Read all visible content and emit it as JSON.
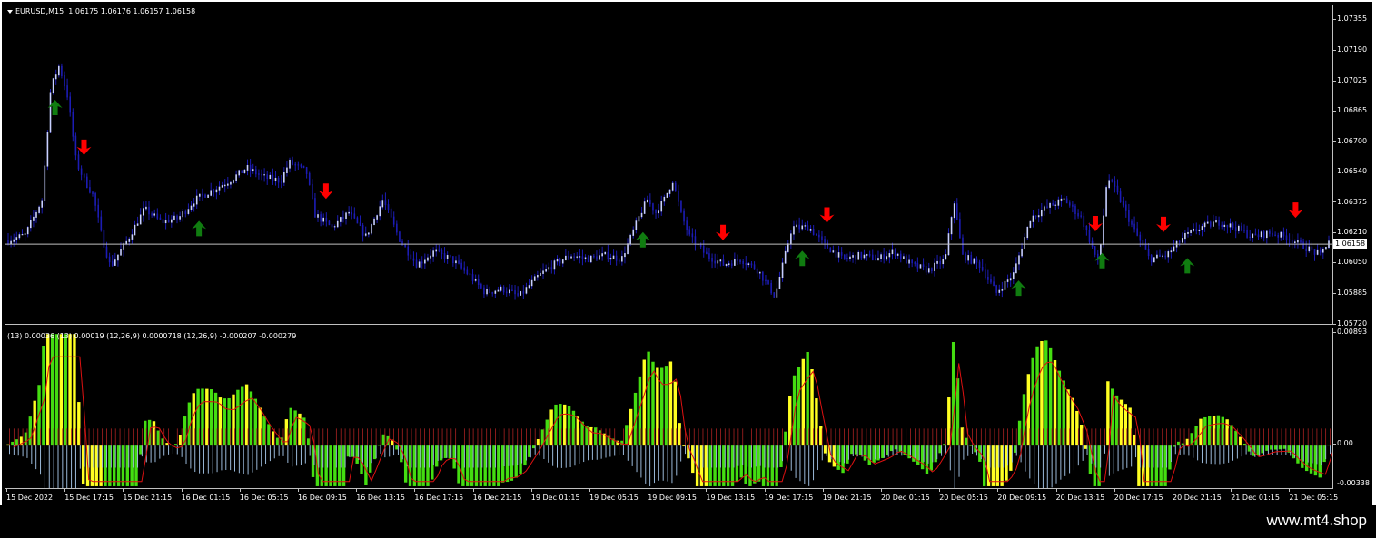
{
  "window": {
    "symbol_label": "EURUSD,M15",
    "ohlc": "1.06175 1.06176 1.06157 1.06158",
    "current_price": "1.06158"
  },
  "indicator_label": "(13) 0.00036  (13) 0.00019  (12,26,9) 0.0000718  (12,26,9) -0.000207 -0.000279",
  "watermark": "www.mt4.shop",
  "colors": {
    "background": "#000000",
    "candle": "#1c1cb4",
    "candle_highlight": "#c8d0ff",
    "bid_line": "#c0c0c0",
    "buy_arrow": "#107c10",
    "sell_arrow": "#ff0000",
    "bull_power": "#44dd11",
    "bear_power": "#ffff22",
    "macd_line": "#dd1111",
    "macd_hist": "#9ab8d8",
    "signal_hist": "#aa2222"
  },
  "icons": {
    "buy": "arrow-up-icon",
    "sell": "arrow-down-icon",
    "collapse": "triangle-down-icon"
  },
  "price_axis": [
    "1.07355",
    "1.07190",
    "1.07025",
    "1.06865",
    "1.06700",
    "1.06540",
    "1.06375",
    "1.06210",
    "1.06050",
    "1.05885",
    "1.05720"
  ],
  "indicator_axis": [
    "0.00893",
    "0.00",
    "-0.00338"
  ],
  "time_axis": [
    "15 Dec 2022",
    "15 Dec 17:15",
    "15 Dec 21:15",
    "16 Dec 01:15",
    "16 Dec 05:15",
    "16 Dec 09:15",
    "16 Dec 13:15",
    "16 Dec 17:15",
    "16 Dec 21:15",
    "19 Dec 01:15",
    "19 Dec 05:15",
    "19 Dec 09:15",
    "19 Dec 13:15",
    "19 Dec 17:15",
    "19 Dec 21:15",
    "20 Dec 01:15",
    "20 Dec 05:15",
    "20 Dec 09:15",
    "20 Dec 13:15",
    "20 Dec 17:15",
    "20 Dec 21:15",
    "21 Dec 01:15",
    "21 Dec 05:15"
  ],
  "chart_data": {
    "type": "line",
    "instrument": "EURUSD",
    "timeframe": "M15",
    "ylim": [
      1.0572,
      1.0744
    ],
    "bid": 1.06158,
    "price_path": [
      [
        0,
        1.0618
      ],
      [
        2,
        1.0621
      ],
      [
        4,
        1.064
      ],
      [
        5,
        1.07
      ],
      [
        6,
        1.0712
      ],
      [
        7,
        1.0695
      ],
      [
        8,
        1.066
      ],
      [
        9,
        1.065
      ],
      [
        10,
        1.0642
      ],
      [
        11,
        1.062
      ],
      [
        12,
        1.0604
      ],
      [
        14,
        1.0618
      ],
      [
        16,
        1.0635
      ],
      [
        18,
        1.0628
      ],
      [
        20,
        1.063
      ],
      [
        22,
        1.064
      ],
      [
        24,
        1.0645
      ],
      [
        26,
        1.065
      ],
      [
        28,
        1.0657
      ],
      [
        30,
        1.0652
      ],
      [
        32,
        1.065
      ],
      [
        33,
        1.066
      ],
      [
        35,
        1.0655
      ],
      [
        36,
        1.0632
      ],
      [
        38,
        1.0625
      ],
      [
        40,
        1.0633
      ],
      [
        42,
        1.062
      ],
      [
        44,
        1.064
      ],
      [
        46,
        1.0618
      ],
      [
        48,
        1.0605
      ],
      [
        50,
        1.0612
      ],
      [
        52,
        1.0608
      ],
      [
        54,
        1.06
      ],
      [
        56,
        1.059
      ],
      [
        58,
        1.0592
      ],
      [
        60,
        1.0588
      ],
      [
        62,
        1.0598
      ],
      [
        64,
        1.0605
      ],
      [
        66,
        1.061
      ],
      [
        68,
        1.0608
      ],
      [
        70,
        1.061
      ],
      [
        72,
        1.0608
      ],
      [
        74,
        1.063
      ],
      [
        75,
        1.064
      ],
      [
        76,
        1.0633
      ],
      [
        77,
        1.064
      ],
      [
        78,
        1.065
      ],
      [
        79,
        1.0632
      ],
      [
        80,
        1.062
      ],
      [
        82,
        1.061
      ],
      [
        84,
        1.0605
      ],
      [
        86,
        1.0608
      ],
      [
        88,
        1.0602
      ],
      [
        90,
        1.0588
      ],
      [
        92,
        1.0625
      ],
      [
        94,
        1.0625
      ],
      [
        96,
        1.0615
      ],
      [
        98,
        1.0608
      ],
      [
        100,
        1.061
      ],
      [
        102,
        1.0608
      ],
      [
        104,
        1.0612
      ],
      [
        106,
        1.0605
      ],
      [
        108,
        1.0602
      ],
      [
        110,
        1.0608
      ],
      [
        111,
        1.064
      ],
      [
        112,
        1.061
      ],
      [
        114,
        1.0605
      ],
      [
        116,
        1.059
      ],
      [
        118,
        1.06
      ],
      [
        120,
        1.063
      ],
      [
        122,
        1.0636
      ],
      [
        124,
        1.064
      ],
      [
        126,
        1.063
      ],
      [
        128,
        1.0605
      ],
      [
        129,
        1.0652
      ],
      [
        130,
        1.0645
      ],
      [
        132,
        1.0625
      ],
      [
        134,
        1.0608
      ],
      [
        136,
        1.061
      ],
      [
        138,
        1.062
      ],
      [
        140,
        1.0625
      ],
      [
        142,
        1.0628
      ],
      [
        144,
        1.0625
      ],
      [
        146,
        1.062
      ],
      [
        148,
        1.0622
      ],
      [
        150,
        1.062
      ],
      [
        152,
        1.0615
      ],
      [
        154,
        1.061
      ],
      [
        155,
        1.0618
      ]
    ],
    "x_range": [
      0,
      155
    ],
    "signals": {
      "buy": [
        5.5,
        22.4,
        74.5,
        93.2,
        118.6,
        128.4,
        138.4
      ],
      "sell": [
        8.9,
        37.3,
        83.9,
        96.1,
        127.6,
        135.6,
        151.1
      ]
    },
    "indicator": {
      "ylim": [
        -0.00338,
        0.00893
      ],
      "series": [
        {
          "name": "(13)",
          "last": 0.00036
        },
        {
          "name": "(13)",
          "last": 0.00019
        },
        {
          "name": "(12,26,9)",
          "last": 7.18e-05
        },
        {
          "name": "(12,26,9)",
          "last": -0.000207
        }
      ]
    }
  }
}
